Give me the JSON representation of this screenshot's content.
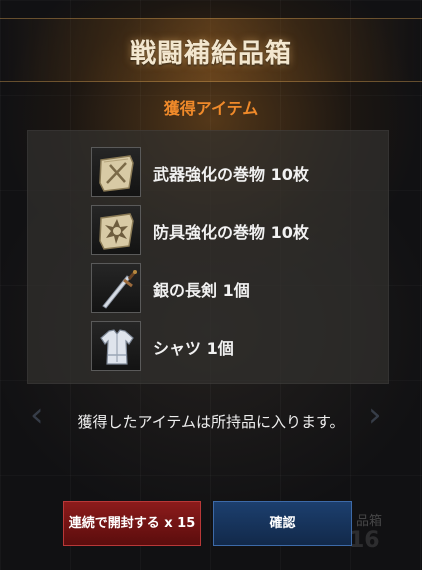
{
  "dialog": {
    "title": "戦闘補給品箱",
    "subtitle": "獲得アイテム",
    "items": [
      {
        "label": "武器強化の巻物 10枚",
        "icon": "weapon-scroll-icon"
      },
      {
        "label": "防具強化の巻物 10枚",
        "icon": "armor-scroll-icon"
      },
      {
        "label": "銀の長剣 1個",
        "icon": "silver-longsword-icon"
      },
      {
        "label": "シャツ 1個",
        "icon": "shirt-icon"
      }
    ],
    "message": "獲得したアイテムは所持品に入ります。",
    "buttons": {
      "continuous_open": "連続で開封する x 15",
      "confirm": "確認"
    },
    "background": {
      "partial_label": "品箱",
      "partial_count": "16"
    }
  },
  "colors": {
    "title": "#f3e7cf",
    "subtitle": "#f08a2a",
    "red_button": "#8c1b1b",
    "blue_button": "#1c3f6e"
  }
}
